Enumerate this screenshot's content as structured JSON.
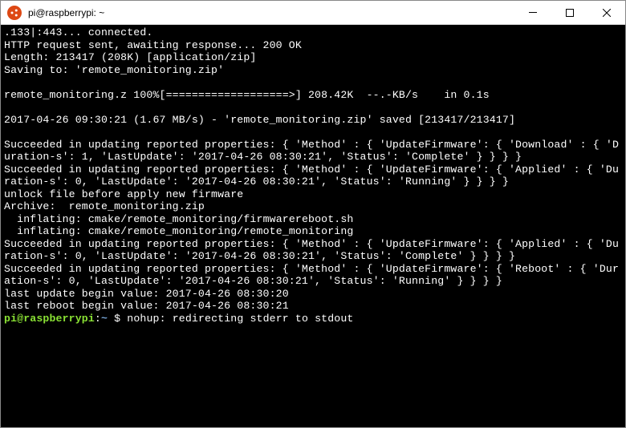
{
  "titlebar": {
    "title": "pi@raspberrypi: ~"
  },
  "terminal": {
    "lines": [
      ".133|:443... connected.",
      "HTTP request sent, awaiting response... 200 OK",
      "Length: 213417 (208K) [application/zip]",
      "Saving to: 'remote_monitoring.zip'",
      "",
      "remote_monitoring.z 100%[===================>] 208.42K  --.-KB/s    in 0.1s",
      "",
      "2017-04-26 09:30:21 (1.67 MB/s) - 'remote_monitoring.zip' saved [213417/213417]",
      "",
      "Succeeded in updating reported properties: { 'Method' : { 'UpdateFirmware': { 'Download' : { 'Duration-s': 1, 'LastUpdate': '2017-04-26 08:30:21', 'Status': 'Complete' } } } }",
      "Succeeded in updating reported properties: { 'Method' : { 'UpdateFirmware': { 'Applied' : { 'Duration-s': 0, 'LastUpdate': '2017-04-26 08:30:21', 'Status': 'Running' } } } }",
      "unlock file before apply new firmware",
      "Archive:  remote_monitoring.zip",
      "  inflating: cmake/remote_monitoring/firmwarereboot.sh",
      "  inflating: cmake/remote_monitoring/remote_monitoring",
      "Succeeded in updating reported properties: { 'Method' : { 'UpdateFirmware': { 'Applied' : { 'Duration-s': 0, 'LastUpdate': '2017-04-26 08:30:21', 'Status': 'Complete' } } } }",
      "Succeeded in updating reported properties: { 'Method' : { 'UpdateFirmware': { 'Reboot' : { 'Duration-s': 0, 'LastUpdate': '2017-04-26 08:30:21', 'Status': 'Running' } } } }",
      "last update begin value: 2017-04-26 08:30:20",
      "last reboot begin value: 2017-04-26 08:30:21"
    ],
    "prompt": {
      "user": "pi@raspberrypi",
      "path": "~",
      "sep": ":",
      "sym": " $ ",
      "after": "nohup: redirecting stderr to stdout"
    }
  }
}
